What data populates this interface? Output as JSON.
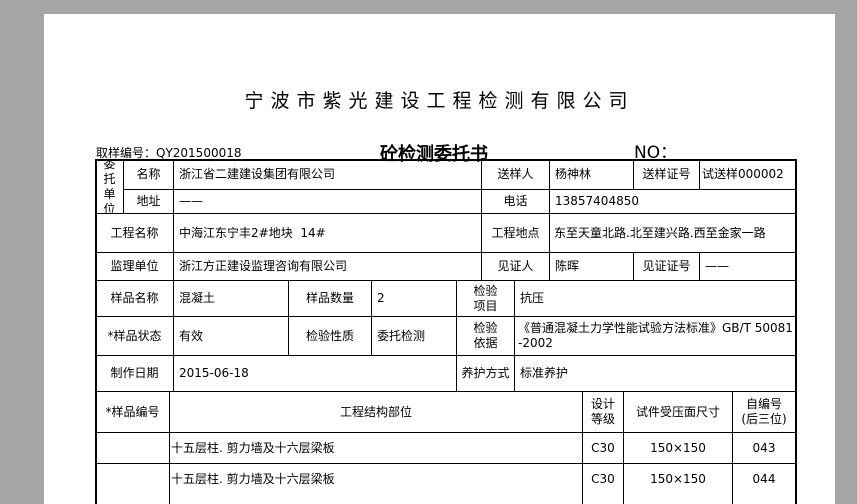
{
  "header": {
    "company": "宁波市紫光建设工程检测有限公司",
    "sample_no": "取样编号：QY201500018",
    "title": "砼检测委托书",
    "no_label": "NO："
  },
  "form": {
    "client_label": "委托单位",
    "name_label": "名称",
    "name_value": "浙江省二建建设集团有限公司",
    "sender_label": "送样人",
    "sender_value": "杨神林",
    "sender_cert_label": "送样证号",
    "sender_cert_value": "试送样000002",
    "address_label": "地址",
    "address_value": "——",
    "phone_label": "电话",
    "phone_value": "13857404850",
    "project_label": "工程名称",
    "project_value": "中海江东宁丰2#地块  14#",
    "location_label": "工程地点",
    "location_value": "东至天童北路.北至建兴路.西至金家一路",
    "supervisor_label": "监理单位",
    "supervisor_value": "浙江方正建设监理咨询有限公司",
    "witness_label": "见证人",
    "witness_value": "陈晖",
    "witness_cert_label": "见证证号",
    "witness_cert_value": "——",
    "sample_name_label": "样品名称",
    "sample_name_value": "混凝土",
    "sample_qty_label": "样品数量",
    "sample_qty_value": "2",
    "test_item_label": "检验项目",
    "test_item_value": "抗压",
    "sample_state_label": "*样品状态",
    "sample_state_value": "有效",
    "test_nature_label": "检验性质",
    "test_nature_value": "委托检测",
    "test_basis_label": "检验依据",
    "test_basis_value": "《普通混凝土力学性能试验方法标准》GB/T 50081-2002",
    "made_date_label": "制作日期",
    "made_date_value": "2015-06-18",
    "curing_label": "养护方式",
    "curing_value": "标准养护"
  },
  "table": {
    "col_sample_no": "*样品编号",
    "col_part": "工程结构部位",
    "col_grade": "设计等级",
    "col_size": "试件受压面尺寸",
    "col_self_no": "自编号(后三位)",
    "rows": [
      {
        "sample_no": "",
        "part": "十五层柱. 剪力墙及十六层梁板",
        "grade": "C30",
        "size": "150×150",
        "self_no": "043"
      },
      {
        "sample_no": "",
        "part": "十五层柱. 剪力墙及十六层梁板",
        "grade": "C30",
        "size": "150×150",
        "self_no": "044"
      }
    ]
  }
}
